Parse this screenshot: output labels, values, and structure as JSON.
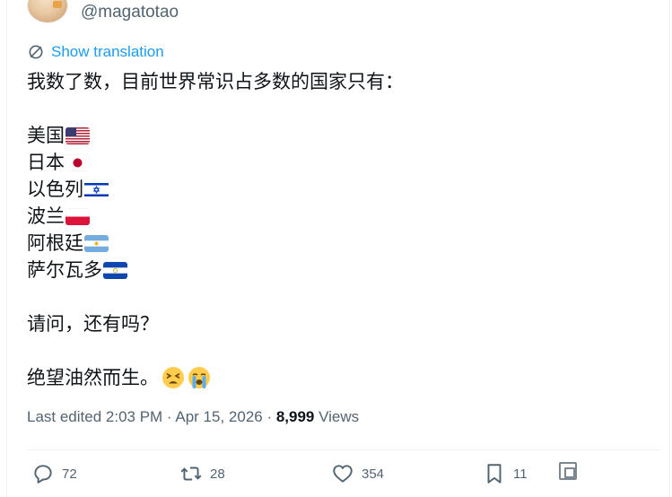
{
  "author": {
    "handle": "@magatotao"
  },
  "translate": {
    "label": "Show translation"
  },
  "post": {
    "intro": "我数了数，目前世界常识占多数的国家只有：",
    "countries": [
      {
        "name": "美国",
        "flag": "us-flag"
      },
      {
        "name": "日本",
        "flag": "jp-flag"
      },
      {
        "name": "以色列",
        "flag": "il-flag"
      },
      {
        "name": "波兰",
        "flag": "pl-flag"
      },
      {
        "name": "阿根廷",
        "flag": "ar-flag"
      },
      {
        "name": "萨尔瓦多",
        "flag": "sv-flag"
      }
    ],
    "question": "请问，还有吗？",
    "closing": "绝望油然而生。",
    "closing_emojis": [
      "tired-face-emoji",
      "loudly-crying-face-emoji"
    ]
  },
  "meta": {
    "edited": "Last edited 2:03 PM · Apr 15, 2026 · ",
    "views_count": "8,999",
    "views_label": " Views"
  },
  "actions": {
    "replies": "72",
    "reposts": "28",
    "likes": "354",
    "bookmarks": "11"
  },
  "colors": {
    "link": "#1d9bf0",
    "muted": "#536471",
    "text": "#0f1419",
    "icon": "#536471"
  }
}
